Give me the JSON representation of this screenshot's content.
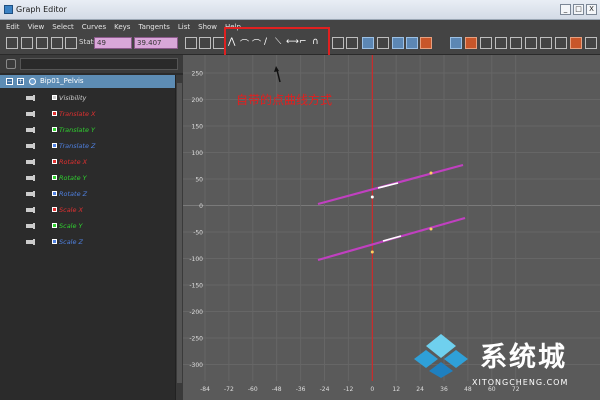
{
  "window": {
    "title": "Graph Editor",
    "controls": [
      "_",
      "□",
      "X"
    ]
  },
  "menu": [
    "Edit",
    "View",
    "Select",
    "Curves",
    "Keys",
    "Tangents",
    "List",
    "Show",
    "Help"
  ],
  "toolbar": {
    "stats_label": "Stats",
    "stat_value_1": "49",
    "stat_value_2": "39.407"
  },
  "annotation": "自带的点曲线方式",
  "outliner": {
    "node": "Bip01_Pelvis",
    "attributes": [
      {
        "label": "Visibility",
        "color": "#cccccc"
      },
      {
        "label": "Translate X",
        "color": "#e03030"
      },
      {
        "label": "Translate Y",
        "color": "#30d030"
      },
      {
        "label": "Translate Z",
        "color": "#4f80e0"
      },
      {
        "label": "Rotate X",
        "color": "#e03030"
      },
      {
        "label": "Rotate Y",
        "color": "#30d030"
      },
      {
        "label": "Rotate Z",
        "color": "#4f80e0"
      },
      {
        "label": "Scale X",
        "color": "#e03030"
      },
      {
        "label": "Scale Y",
        "color": "#30d030"
      },
      {
        "label": "Scale Z",
        "color": "#4f80e0"
      }
    ]
  },
  "graph": {
    "y_ticks": [
      "250",
      "200",
      "150",
      "100",
      "50",
      "0",
      "-50",
      "-100",
      "-150",
      "-200",
      "-250",
      "-300"
    ],
    "x_ticks": [
      "-84",
      "-72",
      "-60",
      "-48",
      "-36",
      "-24",
      "-12",
      "0",
      "12",
      "24",
      "36",
      "48",
      "60",
      "72"
    ],
    "curve_color": "#c040c0",
    "current_frame_color": "#e02020"
  },
  "watermark": {
    "text": "系统城",
    "sub": "XITONGCHENG.COM"
  }
}
